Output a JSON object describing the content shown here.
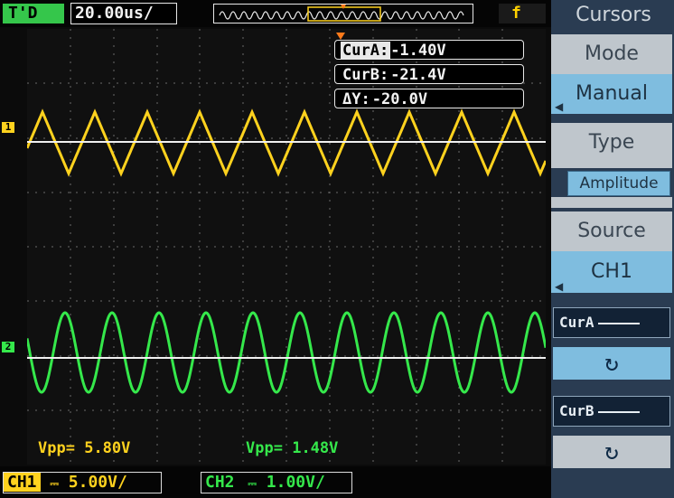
{
  "topbar": {
    "trigger_state": "T'D",
    "timebase": "20.00us/",
    "trigger_icon": "f"
  },
  "cursors": {
    "cura_label": "CurA:",
    "cura_value": "-1.40V",
    "curb_label": "CurB:",
    "curb_value": "-21.4V",
    "delta_label": "ΔY:",
    "delta_value": "-20.0V"
  },
  "channel_markers": {
    "ch1": "1",
    "ch2": "2"
  },
  "measurements": {
    "ch1_vpp_label": "Vpp=",
    "ch1_vpp_value": "5.80V",
    "ch2_vpp_label": "Vpp=",
    "ch2_vpp_value": "1.48V"
  },
  "bottom": {
    "ch1_label": "CH1",
    "ch1_scale": "5.00V/",
    "ch2_label": "CH2",
    "ch2_scale": "1.00V/"
  },
  "menu": {
    "title": "Cursors",
    "mode_label": "Mode",
    "mode_value": "Manual",
    "type_label": "Type",
    "type_value": "Amplitude",
    "source_label": "Source",
    "source_value": "CH1",
    "cura_button": "CurA",
    "curb_button": "CurB",
    "knob_icon": "rotate-icon"
  },
  "colors": {
    "ch1": "#ffd21e",
    "ch2": "#35e84b",
    "menu_bg": "#2a3c52",
    "menu_value": "#7fbddf"
  }
}
